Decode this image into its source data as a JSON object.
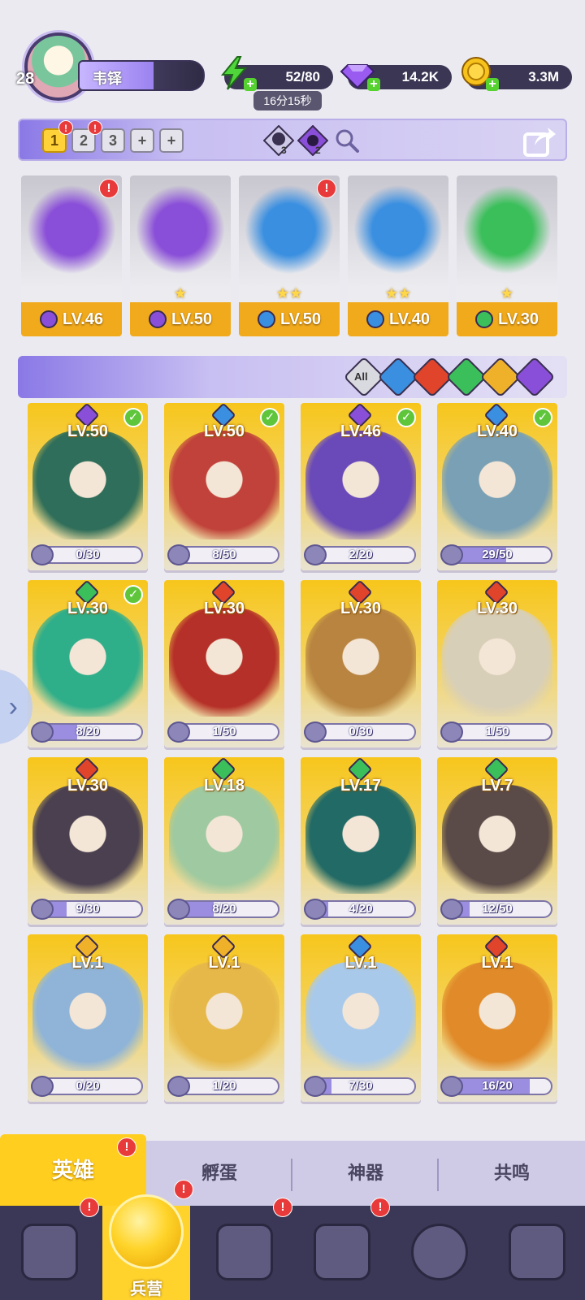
{
  "player": {
    "level": "28",
    "name": "韦铎"
  },
  "resources": {
    "energy": "52/80",
    "energy_timer": "16分15秒",
    "gems": "14.2K",
    "gold": "3.3M"
  },
  "team_bar": {
    "slots": [
      "1",
      "2",
      "3"
    ],
    "slot_badge": "!",
    "icon_a_count": "3",
    "icon_b_count": "2"
  },
  "team": [
    {
      "element": "dark",
      "stars": "",
      "level": "LV.46",
      "badge": "!"
    },
    {
      "element": "dark",
      "stars": "★",
      "level": "LV.50",
      "badge": ""
    },
    {
      "element": "water",
      "stars": "★★",
      "level": "LV.50",
      "badge": "!"
    },
    {
      "element": "water",
      "stars": "★★",
      "level": "LV.40",
      "badge": ""
    },
    {
      "element": "earth",
      "stars": "★",
      "level": "LV.30",
      "badge": ""
    }
  ],
  "filter": {
    "all_label": "All",
    "elements": [
      "water",
      "fire",
      "earth",
      "light",
      "dark"
    ]
  },
  "heroes": [
    {
      "element": "dark",
      "level": "LV.50",
      "shards": "0/30",
      "progress": 0.0,
      "check": true,
      "art": "#2f6e5a"
    },
    {
      "element": "water",
      "level": "LV.50",
      "shards": "8/50",
      "progress": 0.16,
      "check": true,
      "art": "#c0423a"
    },
    {
      "element": "dark",
      "level": "LV.46",
      "shards": "2/20",
      "progress": 0.1,
      "check": true,
      "art": "#6a4ab8"
    },
    {
      "element": "water",
      "level": "LV.40",
      "shards": "29/50",
      "progress": 0.58,
      "check": true,
      "art": "#7aa0b5"
    },
    {
      "element": "earth",
      "level": "LV.30",
      "shards": "8/20",
      "progress": 0.4,
      "check": true,
      "art": "#2fae8a"
    },
    {
      "element": "fire",
      "level": "LV.30",
      "shards": "1/50",
      "progress": 0.02,
      "check": false,
      "art": "#b53028"
    },
    {
      "element": "fire",
      "level": "LV.30",
      "shards": "0/30",
      "progress": 0.0,
      "check": false,
      "art": "#b88440"
    },
    {
      "element": "fire",
      "level": "LV.30",
      "shards": "1/50",
      "progress": 0.02,
      "check": false,
      "art": "#d8cfb8"
    },
    {
      "element": "fire",
      "level": "LV.30",
      "shards": "9/30",
      "progress": 0.3,
      "check": false,
      "art": "#4a4050"
    },
    {
      "element": "earth",
      "level": "LV.18",
      "shards": "8/20",
      "progress": 0.4,
      "check": false,
      "art": "#9fc9a0"
    },
    {
      "element": "earth",
      "level": "LV.17",
      "shards": "4/20",
      "progress": 0.2,
      "check": false,
      "art": "#226a66"
    },
    {
      "element": "earth",
      "level": "LV.7",
      "shards": "12/50",
      "progress": 0.24,
      "check": false,
      "art": "#5a4a48"
    },
    {
      "element": "light",
      "level": "LV.1",
      "shards": "0/20",
      "progress": 0.0,
      "check": false,
      "art": "#8fb4d8"
    },
    {
      "element": "light",
      "level": "LV.1",
      "shards": "1/20",
      "progress": 0.05,
      "check": false,
      "art": "#e6b84a"
    },
    {
      "element": "water",
      "level": "LV.1",
      "shards": "7/30",
      "progress": 0.23,
      "check": false,
      "art": "#a9c9ea"
    },
    {
      "element": "fire",
      "level": "LV.1",
      "shards": "16/20",
      "progress": 0.8,
      "check": false,
      "art": "#e08a2a"
    }
  ],
  "sub_tabs": [
    "英雄",
    "孵蛋",
    "神器",
    "共鸣"
  ],
  "sub_tab_badge": "!",
  "bottom_nav": {
    "active_label": "兵营",
    "badge": "!"
  },
  "colors": {
    "dark": "#8a4fd8",
    "water": "#3a8fe0",
    "fire": "#e0442a",
    "earth": "#3bbf5a",
    "light": "#f0b12a",
    "accent": "#ffce1e"
  }
}
